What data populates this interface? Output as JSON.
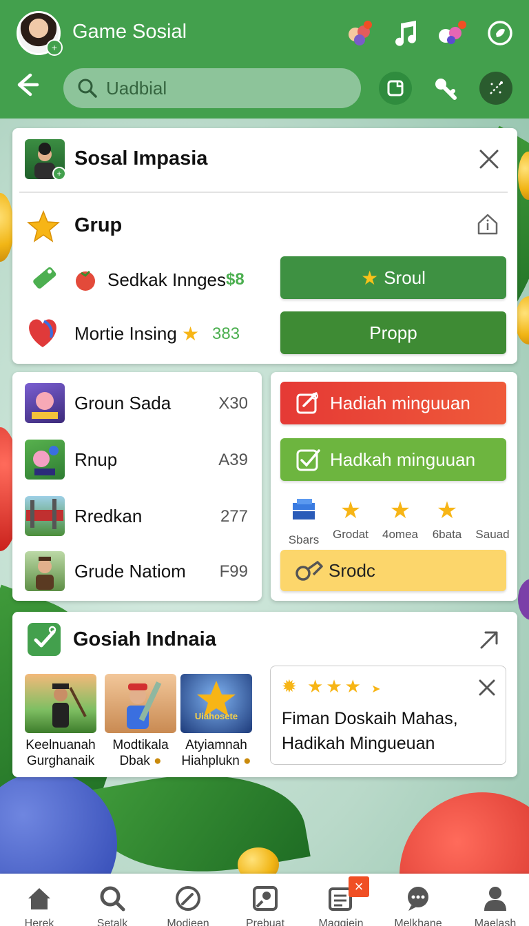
{
  "header": {
    "app_title": "Game Sosial",
    "search_placeholder": "Uadbial"
  },
  "profile_card": {
    "title": "Sosal Impasia",
    "section_title": "Grup",
    "items": [
      {
        "label": "Sedkak Innges",
        "value": "$8"
      },
      {
        "label": "Mortie Insing",
        "value": "383"
      }
    ],
    "primary_button": "Sroul",
    "secondary_button": "Propp"
  },
  "group_list": {
    "rows": [
      {
        "label": "Groun Sada",
        "value": "X30"
      },
      {
        "label": "Rnup",
        "value": "A39"
      },
      {
        "label": "Rredkan",
        "value": "277"
      },
      {
        "label": "Grude Natiom",
        "value": "F99"
      }
    ]
  },
  "rewards": {
    "button_1": "Hadiah minguuan",
    "button_2": "Hadkah minguuan",
    "stars": [
      {
        "label": "Sbars",
        "icon": "box-icon"
      },
      {
        "label": "Grodat",
        "icon": "star-icon"
      },
      {
        "label": "4omea",
        "icon": "star-icon"
      },
      {
        "label": "6bata",
        "icon": "star-icon"
      },
      {
        "label": "Sauad",
        "icon": "none"
      }
    ],
    "yellow_button": "Srodc"
  },
  "bottom_card": {
    "title": "Gosiah Indnaia",
    "games": [
      {
        "name_line1": "Keelnuanah",
        "name_line2": "Gurghanaik"
      },
      {
        "name_line1": "Modtikala",
        "name_line2": "Dbak"
      },
      {
        "name_line1": "Atyiamnah",
        "name_line2": "Hiahplukn",
        "badge": "Uiahosete"
      }
    ],
    "notice": {
      "rating_stars": 3,
      "text_line1": "Fiman Doskaih Mahas,",
      "text_line2": "Hadikah Mingueuan"
    }
  },
  "bottom_nav": {
    "items": [
      "Herek",
      "Setalk",
      "Modieen",
      "Prebuat",
      "Maggiein",
      "Melkhane",
      "Maelash"
    ]
  },
  "colors": {
    "header_green": "#43a04d",
    "button_green": "#3e9142",
    "button_light_green": "#6db53f",
    "button_red": "#e53935",
    "button_yellow": "#fcd66b",
    "badge_orange": "#f04f24"
  }
}
